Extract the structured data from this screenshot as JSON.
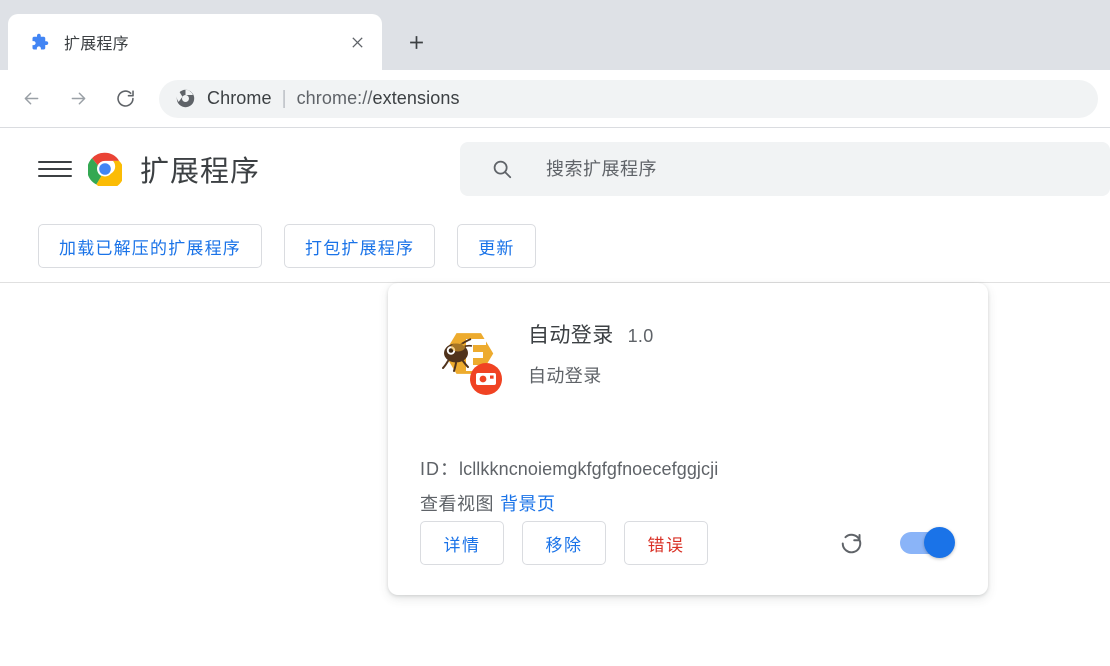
{
  "browser": {
    "tab": {
      "title": "扩展程序",
      "favicon": "puzzle-piece-icon",
      "close_label": "×"
    },
    "newtab_label": "+",
    "nav": {
      "back": "←",
      "forward": "→",
      "reload": "⟳"
    },
    "omnibox": {
      "scheme_label": "Chrome",
      "separator": "|",
      "url_prefix": "chrome://",
      "url_suffix": "extensions",
      "full_url": "chrome://extensions"
    }
  },
  "page": {
    "menu_label": "菜单",
    "title": "扩展程序",
    "search": {
      "placeholder": "搜索扩展程序",
      "value": ""
    },
    "toolbar_buttons": [
      {
        "label": "加载已解压的扩展程序",
        "name": "load-unpacked-button"
      },
      {
        "label": "打包扩展程序",
        "name": "pack-extension-button"
      },
      {
        "label": "更新",
        "name": "update-button"
      }
    ],
    "extension": {
      "name": "自动登录",
      "version": "1.0",
      "description": "自动登录",
      "id_label": "ID：",
      "id_value": "lcllkkncnoiemgkfgfgfnoecefggjcji",
      "views_label": "查看视图",
      "views_link": "背景页",
      "actions": {
        "details": "详情",
        "remove": "移除",
        "errors": "错误"
      },
      "reload_title": "重新加载",
      "enabled": true
    }
  },
  "colors": {
    "accent_blue": "#1a73e8",
    "error_red": "#d93025",
    "toggle_track": "#8ab4f8",
    "tabstrip_bg": "#dee1e6",
    "omnibox_bg": "#f1f3f4",
    "text_primary": "#3c4043",
    "text_secondary": "#5f6368"
  }
}
